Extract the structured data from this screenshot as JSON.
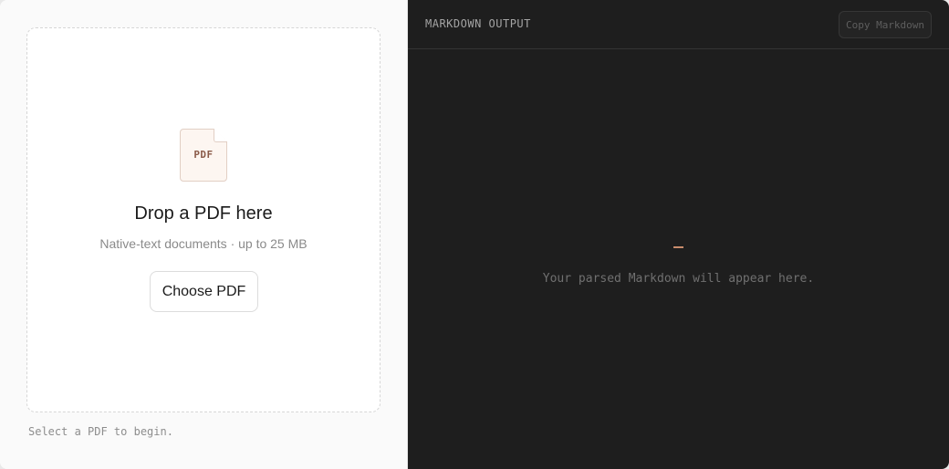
{
  "upload": {
    "file_icon_label": "PDF",
    "title": "Drop a PDF here",
    "subtitle": "Native-text documents · up to 25 MB",
    "choose_button": "Choose PDF",
    "status": "Select a PDF to begin."
  },
  "output": {
    "title": "MARKDOWN OUTPUT",
    "copy_button": "Copy Markdown",
    "placeholder": "Your parsed Markdown will appear here."
  },
  "colors": {
    "accent": "#c98c6c",
    "output_bg": "#1e1e1e",
    "upload_bg": "#fafafa"
  },
  "icons": {
    "file": "pdf-file-icon",
    "cursor": "cursor-icon"
  }
}
